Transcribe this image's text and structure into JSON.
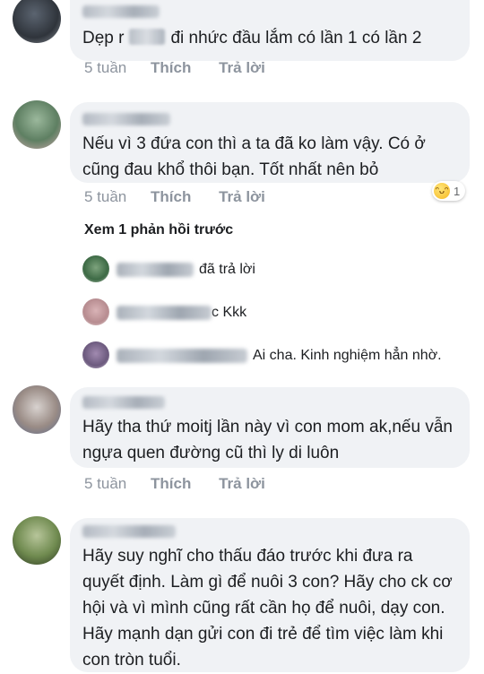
{
  "comments": [
    {
      "text_before_blur": "Dẹp r",
      "text_after_blur": "đi nhức đầu lắm có lần 1 có lần 2",
      "time": "5 tuần",
      "like": "Thích",
      "reply": "Trả lời"
    },
    {
      "text": "Nếu vì 3 đứa con thì a ta đã ko làm vậy. Có ở cũng đau khổ thôi bạn. Tốt nhất nên bỏ",
      "time": "5 tuần",
      "like": "Thích",
      "reply": "Trả lời",
      "reaction": {
        "icon": "haha-emoji-icon",
        "count": "1"
      }
    },
    {
      "text": "Hãy tha thứ moitj lần này vì con mom ak,nếu vẫn ngựa quen đường cũ thì ly di luôn",
      "time": "5 tuần",
      "like": "Thích",
      "reply": "Trả lời"
    },
    {
      "text": "Hãy suy nghĩ cho thấu đáo trước khi đưa ra quyết định. Làm gì để nuôi 3 con? Hãy cho ck cơ hội và vì mình cũng rất cần họ để nuôi, dạy con. Hãy mạnh dạn gửi con đi trẻ để tìm việc làm khi con tròn tuổi."
    }
  ],
  "see_more_replies": "Xem 1 phản hồi trước",
  "replies": [
    {
      "text": "đã trả lời"
    },
    {
      "text": "c Kkk"
    },
    {
      "text": "Ai cha. Kinh nghiệm hẳn nhờ."
    }
  ],
  "colors": {
    "bubble": "#f0f2f5",
    "meta": "#8d949e",
    "text": "#1c1e21"
  }
}
